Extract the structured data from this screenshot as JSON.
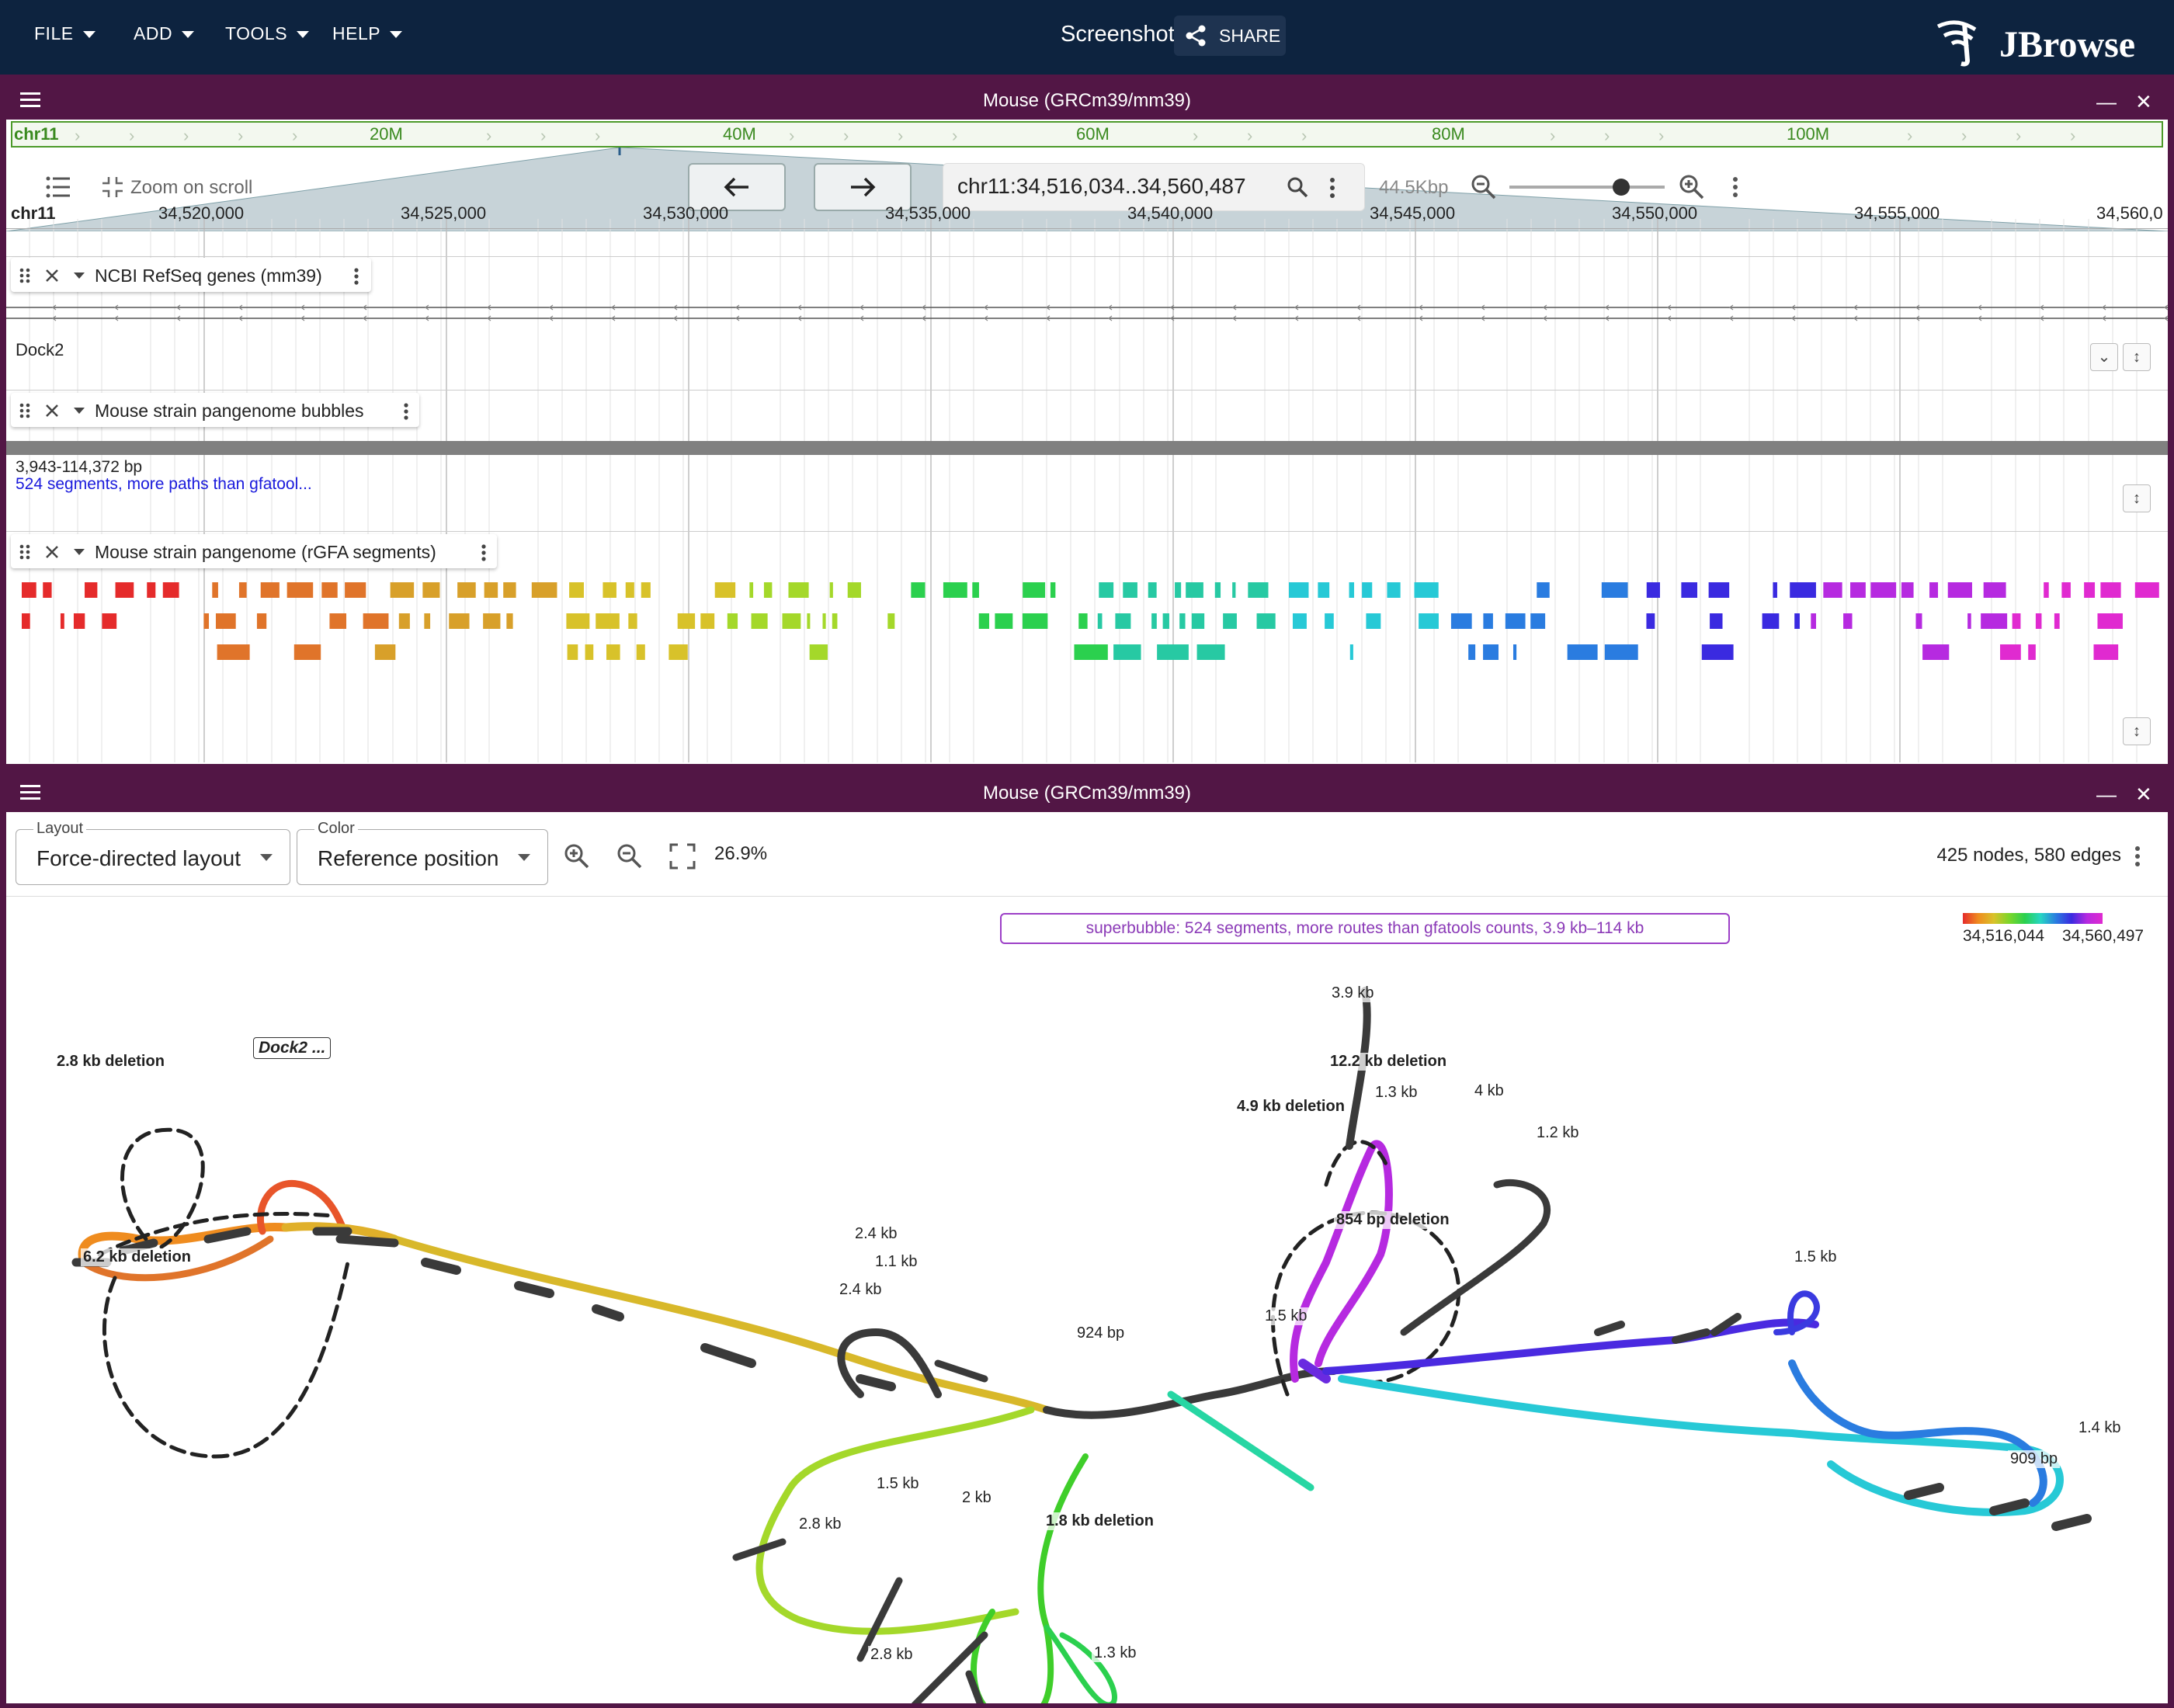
{
  "app": {
    "menus": [
      "FILE",
      "ADD",
      "TOOLS",
      "HELP"
    ],
    "screenshot_title": "Screenshot",
    "share_label": "SHARE",
    "logo_text": "JBrowse"
  },
  "linear_view": {
    "title": "Mouse (GRCm39/mm39)",
    "overview": {
      "chrom": "chr11",
      "ticks": [
        "20M",
        "40M",
        "60M",
        "80M",
        "100M"
      ]
    },
    "zoom_on_scroll_label": "Zoom on scroll",
    "location": "chr11:34,516,034..34,560,487",
    "span_label": "44.5Kbp",
    "zoom_slider": 0.72,
    "ruler": {
      "chrom": "chr11",
      "ticks": [
        "34,520,000",
        "34,525,000",
        "34,530,000",
        "34,535,000",
        "34,540,000",
        "34,545,000",
        "34,550,000",
        "34,555,000",
        "34,560,0"
      ]
    },
    "tracks": {
      "refseq": {
        "name": "NCBI RefSeq genes (mm39)",
        "gene": "Dock2"
      },
      "bubbles": {
        "name": "Mouse strain pangenome bubbles",
        "range": "3,943-114,372 bp",
        "desc": "524 segments, more paths than gfatool..."
      },
      "rgfa": {
        "name": "Mouse strain pangenome (rGFA segments)"
      }
    }
  },
  "graph_view": {
    "title": "Mouse (GRCm39/mm39)",
    "layout_label": "Layout",
    "layout_value": "Force-directed layout",
    "color_label": "Color",
    "color_value": "Reference position",
    "zoom_pct": "26.9%",
    "stats": "425 nodes, 580 edges",
    "superbubble": "superbubble: 524 segments, more routes than gfatools counts, 3.9 kb–114 kb",
    "legend_min": "34,516,044",
    "legend_max": "34,560,497",
    "gene_label": "Dock2 ...",
    "labels": [
      "2.8 kb deletion",
      "6.2 kb deletion",
      "3.9 kb",
      "12.2 kb deletion",
      "1.3 kb",
      "4 kb",
      "4.9 kb deletion",
      "1.2 kb",
      "854 bp deletion",
      "2.4 kb",
      "1.1 kb",
      "2.4 kb",
      "1.5 kb",
      "1.5 kb",
      "924 bp",
      "1.5 kb",
      "2 kb",
      "1.4 kb",
      "909 bp",
      "2.8 kb",
      "1.8 kb deletion",
      "2.8 kb",
      "1.3 kb"
    ]
  }
}
